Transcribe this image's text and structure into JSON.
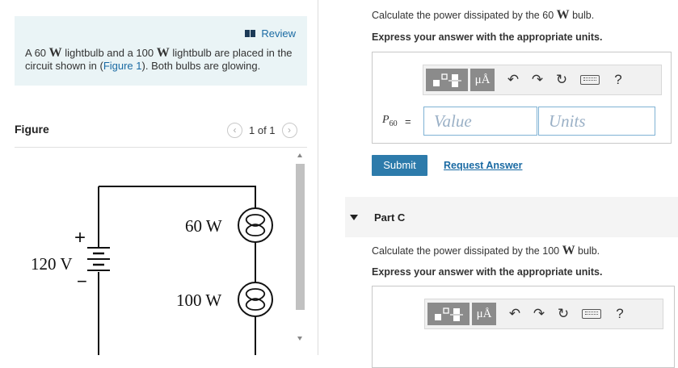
{
  "intro": {
    "review": "Review",
    "text_before_q1": "A 60 ",
    "unit1": "W",
    "text_mid": " lightbulb and a 100 ",
    "unit2": "W",
    "text_after": " lightbulb are placed in the circuit shown in (",
    "figure_link": "Figure 1",
    "text_end": "). Both bulbs are glowing."
  },
  "figure": {
    "label": "Figure",
    "pager": "1 of 1",
    "bulb1_label": "60 W",
    "bulb2_label": "100 W",
    "battery_label": "120 V",
    "plus": "+",
    "minus": "−"
  },
  "part_b": {
    "question_prefix": "Calculate the power dissipated by the 60 ",
    "unit": "W",
    "question_suffix": " bulb.",
    "instructions": "Express your answer with the appropriate units.",
    "var_symbol": "P",
    "var_subscript": "60",
    "equals": "=",
    "value_placeholder": "Value",
    "units_placeholder": "Units",
    "submit": "Submit",
    "request_answer": "Request Answer"
  },
  "part_c": {
    "title": "Part C",
    "question_prefix": "Calculate the power dissipated by the 100 ",
    "unit": "W",
    "question_suffix": " bulb.",
    "instructions": "Express your answer with the appropriate units."
  },
  "toolbar": {
    "units_glyph": "μÅ",
    "help": "?",
    "undo": "↶",
    "redo": "↷",
    "reset": "↻"
  }
}
